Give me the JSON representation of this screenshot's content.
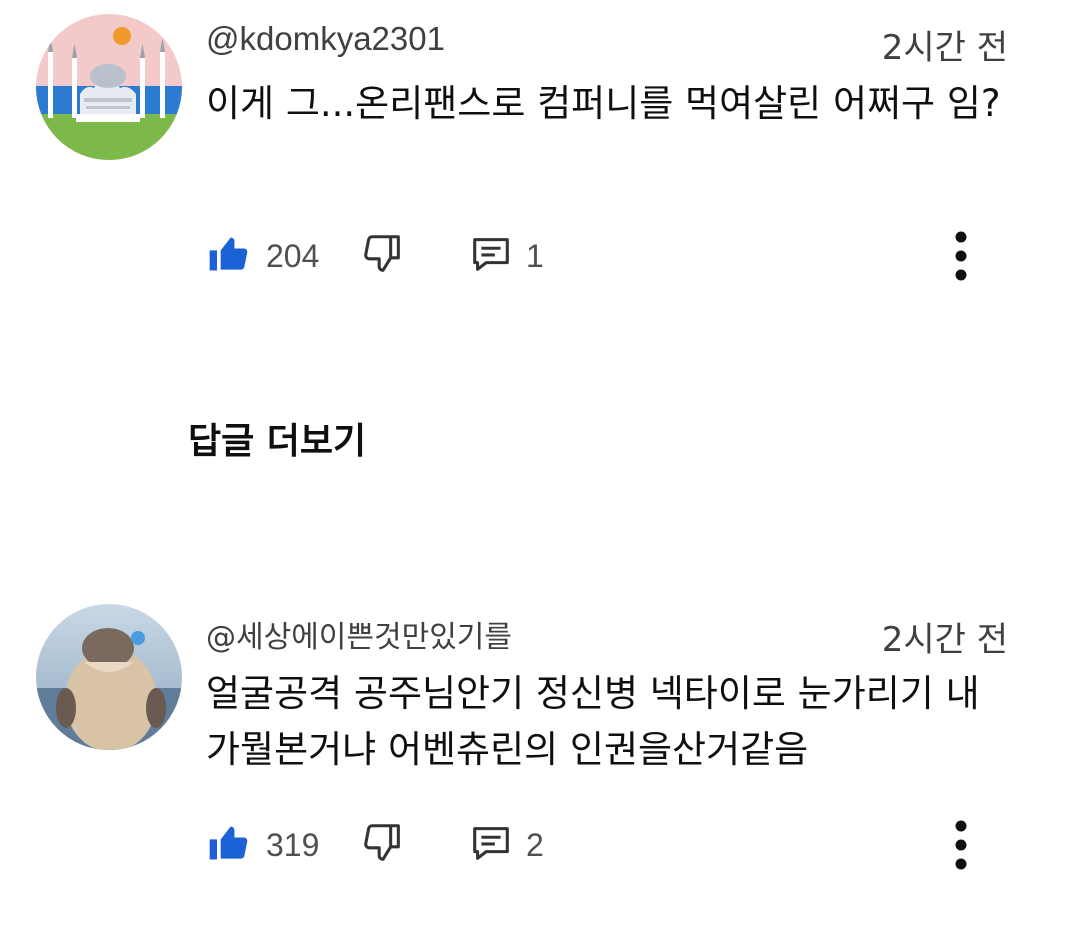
{
  "comments": [
    {
      "handle": "@kdomkya2301",
      "time": "2시간 전",
      "text": "이게 그...온리팬스로 컴퍼니를 먹여살린 어쩌구 임?",
      "likes": "204",
      "replies": "1",
      "icons": {
        "like": "thumbs-up-filled-icon",
        "dislike": "thumbs-down-icon",
        "reply": "reply-comment-icon",
        "more": "more-vert-icon"
      }
    },
    {
      "handle": "@세상에이쁜것만있기를",
      "time": "2시간 전",
      "text": "얼굴공격 공주님안기 정신병 넥타이로 눈가리기 내 가뭘본거냐 어벤츄린의 인권을산거같음",
      "likes": "319",
      "replies": "2",
      "icons": {
        "like": "thumbs-up-filled-icon",
        "dislike": "thumbs-down-icon",
        "reply": "reply-comment-icon",
        "more": "more-vert-icon"
      }
    }
  ],
  "more_replies_label": "답글 더보기",
  "colors": {
    "like_blue": "#1a62d6",
    "text": "#0f0f0f",
    "secondary": "#404040"
  }
}
